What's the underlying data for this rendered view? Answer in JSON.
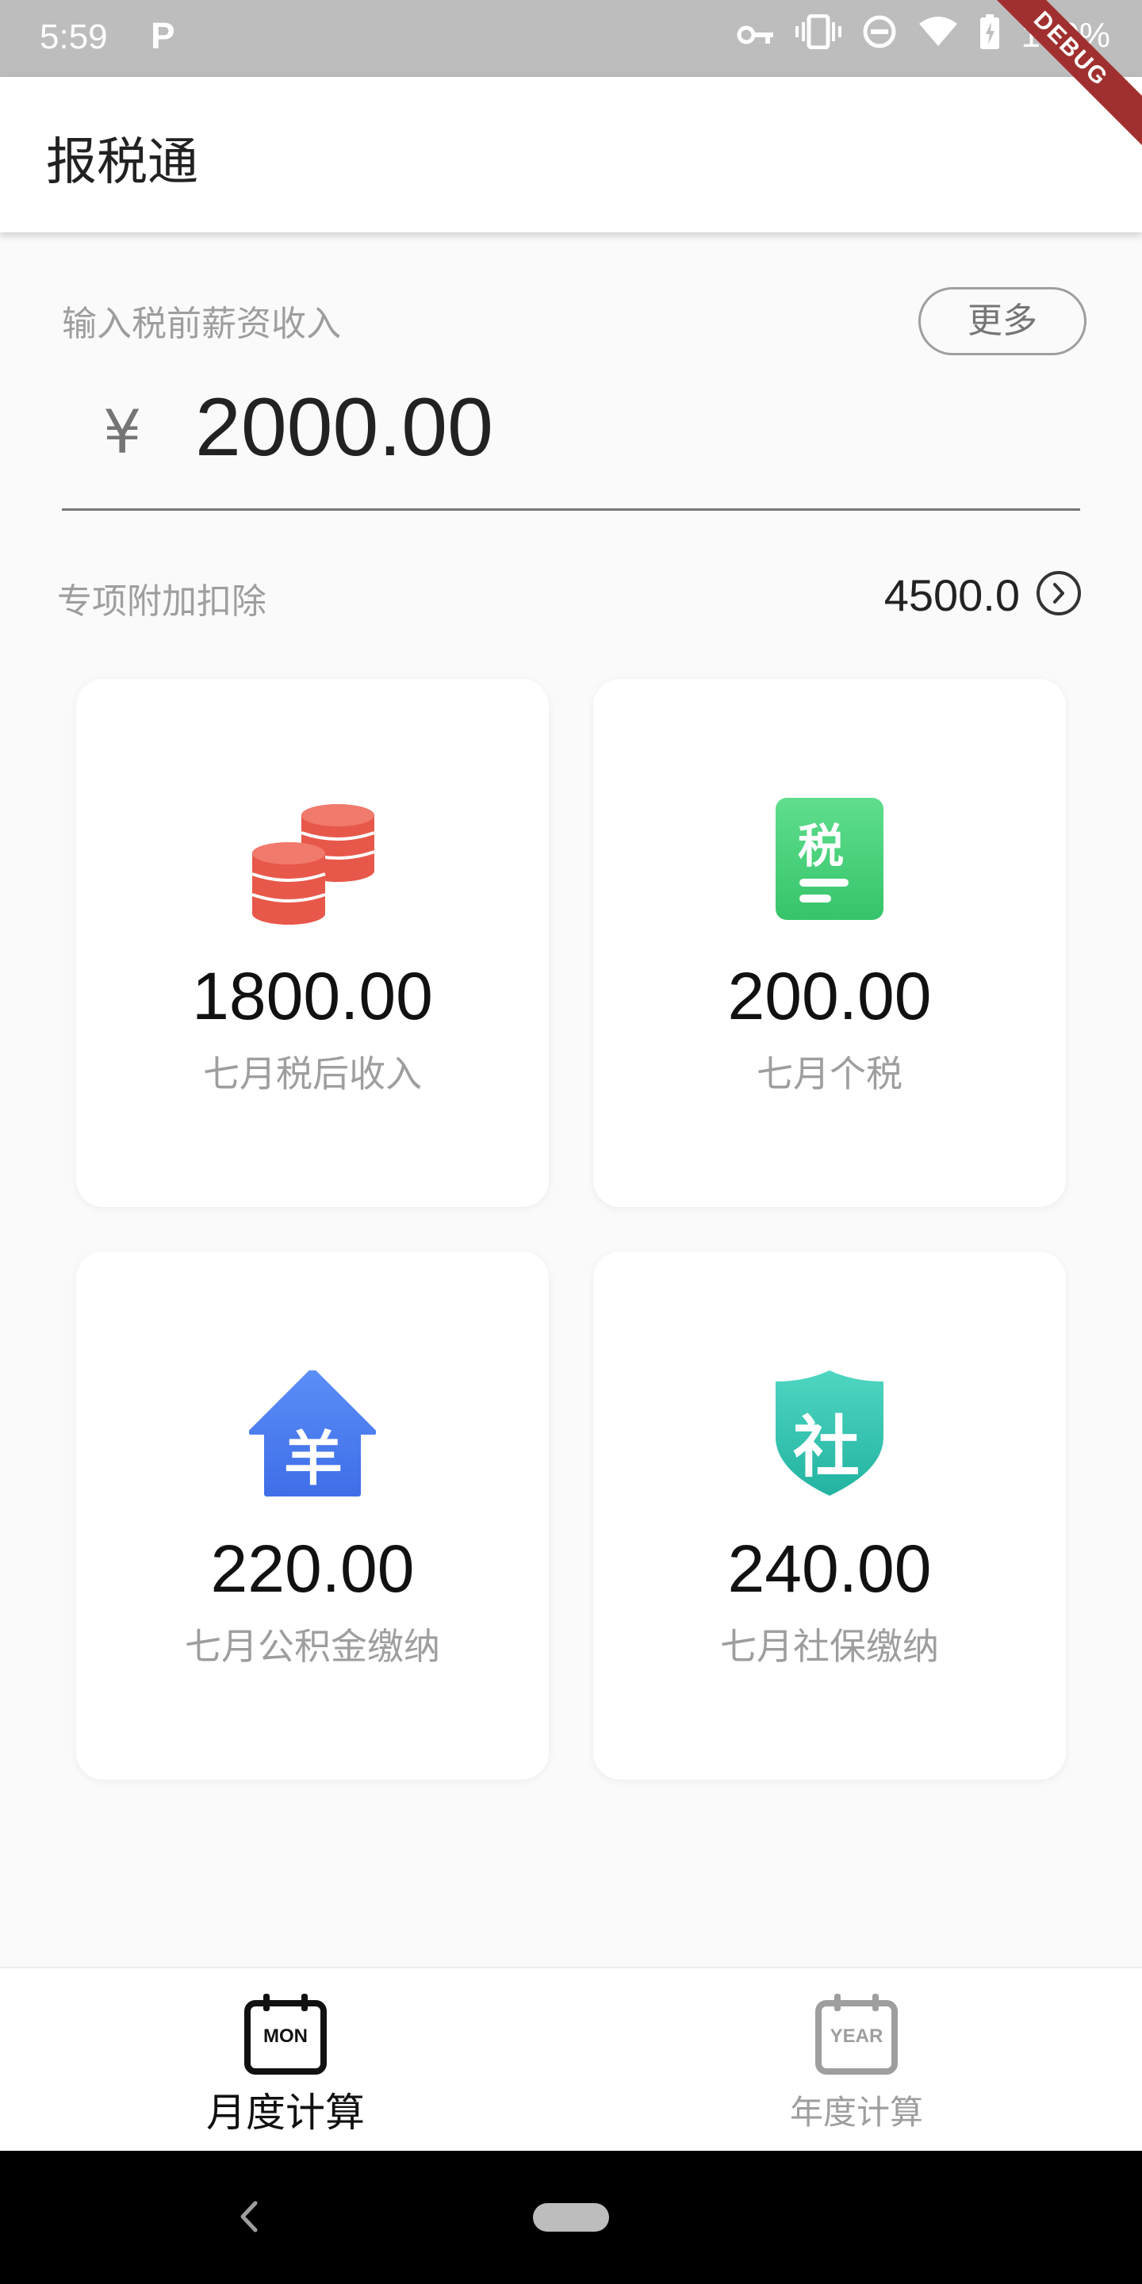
{
  "status_bar": {
    "time": "5:59",
    "notification_letter": "P",
    "battery": "100%"
  },
  "debug_ribbon": "DEBUG",
  "app_bar": {
    "title": "报税通"
  },
  "income": {
    "label": "输入税前薪资收入",
    "more_label": "更多",
    "currency": "¥",
    "amount": "2000.00"
  },
  "deduction": {
    "label": "专项附加扣除",
    "value": "4500.0"
  },
  "cards": [
    {
      "value": "1800.00",
      "label": "七月税后收入",
      "icon": "coins-icon",
      "color": "#e8584a"
    },
    {
      "value": "200.00",
      "label": "七月个税",
      "icon": "tax-icon",
      "glyph": "税",
      "color": "#3ecf76"
    },
    {
      "value": "220.00",
      "label": "七月公积金缴纳",
      "icon": "housing-fund-icon",
      "glyph": "羊",
      "color": "#4a7cf0"
    },
    {
      "value": "240.00",
      "label": "七月社保缴纳",
      "icon": "social-security-shield-icon",
      "glyph": "社",
      "color": "#2ec4b0"
    }
  ],
  "bottom_nav": {
    "items": [
      {
        "label": "月度计算",
        "icon_text": "MON",
        "active": true
      },
      {
        "label": "年度计算",
        "icon_text": "YEAR",
        "active": false
      }
    ]
  },
  "colors": {
    "active": "#111111",
    "inactive": "#9e9e9e"
  }
}
